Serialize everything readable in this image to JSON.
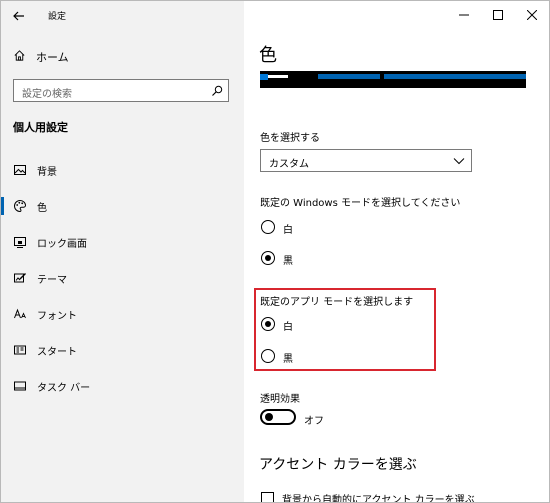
{
  "window": {
    "title": "設定"
  },
  "sidebar": {
    "home_label": "ホーム",
    "search_placeholder": "設定の検索",
    "section_heading": "個人用設定",
    "items": [
      {
        "label": "背景",
        "icon": "image-icon"
      },
      {
        "label": "色",
        "icon": "palette-icon",
        "active": true
      },
      {
        "label": "ロック画面",
        "icon": "lock-screen-icon"
      },
      {
        "label": "テーマ",
        "icon": "theme-icon"
      },
      {
        "label": "フォント",
        "icon": "font-icon"
      },
      {
        "label": "スタート",
        "icon": "start-icon"
      },
      {
        "label": "タスク バー",
        "icon": "taskbar-icon"
      }
    ]
  },
  "main": {
    "title": "色",
    "choose_color_label": "色を選択する",
    "choose_color_value": "カスタム",
    "windows_mode_label": "既定の Windows モードを選択してください",
    "windows_mode_options": [
      {
        "label": "白",
        "selected": false
      },
      {
        "label": "黒",
        "selected": true
      }
    ],
    "app_mode_label": "既定のアプリ モードを選択します",
    "app_mode_options": [
      {
        "label": "白",
        "selected": true
      },
      {
        "label": "黒",
        "selected": false
      }
    ],
    "transparency_label": "透明効果",
    "transparency_state": "オフ",
    "accent_heading": "アクセント カラーを選ぶ",
    "accent_auto_label": "背景から自動的にアクセント カラーを選ぶ"
  },
  "colors": {
    "accent": "#0063b1",
    "highlight_box": "#d8262f",
    "sidebar_bg": "#f2f2f2"
  }
}
